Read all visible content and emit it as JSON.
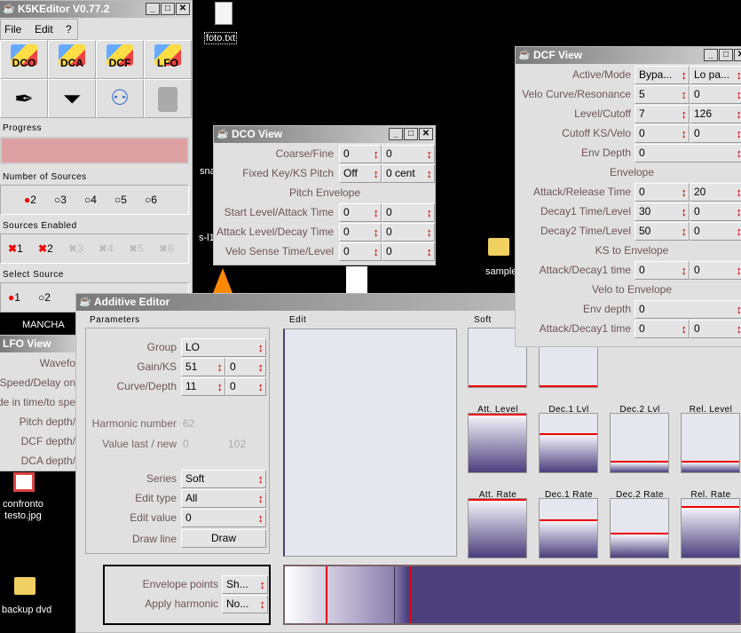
{
  "desktop": {
    "icons": [
      {
        "label": "foto.txt"
      },
      {
        "label": "sna"
      },
      {
        "label": "s-l1"
      },
      {
        "label": "sample"
      },
      {
        "label": "confronto\ntesto.jpg"
      },
      {
        "label": "backup dvd"
      },
      {
        "label": "MANCHA"
      }
    ]
  },
  "k5k": {
    "title": "K5KEditor V0.77.2",
    "menu": [
      "File",
      "Edit",
      "?"
    ],
    "toolbar": [
      "DCO",
      "DCA",
      "DCF",
      "LFO"
    ],
    "progress_label": "Progress",
    "progress": 0,
    "num_sources_label": "Number of Sources",
    "num_sources": [
      "2",
      "3",
      "4",
      "5",
      "6"
    ],
    "num_sources_selected": "2",
    "enabled_label": "Sources Enabled",
    "enabled": [
      "1",
      "2",
      "3",
      "4",
      "5",
      "6"
    ],
    "select_label": "Select Source",
    "select": [
      "1",
      "2"
    ],
    "select_selected": "1"
  },
  "lfo": {
    "title": "LFO View",
    "labels": [
      "Wavefo",
      "Speed/Delay on",
      "de in time/to spe",
      "Pitch depth/",
      "DCF depth/",
      "DCA depth/"
    ]
  },
  "dco": {
    "title": "DCO View",
    "rows": [
      {
        "label": "Coarse/Fine",
        "values": [
          "0",
          "0"
        ]
      },
      {
        "label": "Fixed Key/KS Pitch",
        "values": [
          "Off",
          "0 cent"
        ]
      },
      {
        "section": "Pitch Envelope"
      },
      {
        "label": "Start Level/Attack Time",
        "values": [
          "0",
          "0"
        ]
      },
      {
        "label": "Attack Level/Decay Time",
        "values": [
          "0",
          "0"
        ]
      },
      {
        "label": "Velo Sense Time/Level",
        "values": [
          "0",
          "0"
        ]
      }
    ]
  },
  "dcf": {
    "title": "DCF View",
    "rows": [
      {
        "label": "Active/Mode",
        "values": [
          "Bypa...",
          "Lo pa..."
        ]
      },
      {
        "label": "Velo Curve/Resonance",
        "values": [
          "5",
          "0"
        ]
      },
      {
        "label": "Level/Cutoff",
        "values": [
          "7",
          "126"
        ]
      },
      {
        "label": "Cutoff KS/Velo",
        "values": [
          "0",
          "0"
        ]
      },
      {
        "label": "Env Depth",
        "values": [
          "0"
        ]
      },
      {
        "section": "Envelope"
      },
      {
        "label": "Attack/Release Time",
        "values": [
          "0",
          "20"
        ]
      },
      {
        "label": "Decay1 Time/Level",
        "values": [
          "30",
          "0"
        ]
      },
      {
        "label": "Decay2 Time/Level",
        "values": [
          "50",
          "0"
        ]
      },
      {
        "section": "KS to Envelope"
      },
      {
        "label": "Attack/Decay1 time",
        "values": [
          "0",
          "0"
        ]
      },
      {
        "section": "Velo to Envelope"
      },
      {
        "label": "Env depth",
        "values": [
          "0"
        ]
      },
      {
        "label": "Attack/Decay1 time",
        "values": [
          "0",
          "0"
        ]
      }
    ]
  },
  "additive": {
    "title": "Additive Editor",
    "parameters_label": "Parameters",
    "edit_label": "Edit",
    "soft_label": "Soft",
    "params": [
      {
        "label": "Group",
        "values": [
          "LO"
        ]
      },
      {
        "label": "Gain/KS",
        "values": [
          "51",
          "0"
        ]
      },
      {
        "label": "Curve/Depth",
        "values": [
          "11",
          "0"
        ]
      }
    ],
    "harmonic_label": "Harmonic number",
    "harmonic": "62",
    "value_label": "Value last / new",
    "value_last": "0",
    "value_new": "102",
    "params2": [
      {
        "label": "Series",
        "values": [
          "Soft"
        ]
      },
      {
        "label": "Edit type",
        "values": [
          "All"
        ]
      },
      {
        "label": "Edit value",
        "values": [
          "0"
        ]
      }
    ],
    "draw_line_label": "Draw line",
    "draw_button": "Draw",
    "bottom": [
      {
        "label": "Envelope points",
        "values": [
          "Sh..."
        ]
      },
      {
        "label": "Apply harmonic",
        "values": [
          "No..."
        ]
      }
    ],
    "levels": [
      {
        "label": "Att. Level",
        "value": 97
      },
      {
        "label": "Dec.1 Lvl",
        "value": 63
      },
      {
        "label": "Dec.2 Lvl",
        "value": 17
      },
      {
        "label": "Rel. Level",
        "value": 17
      }
    ],
    "rates": [
      {
        "label": "Att. Rate",
        "value": 97
      },
      {
        "label": "Dec.1 Rate",
        "value": 62
      },
      {
        "label": "Dec.2 Rate",
        "value": 40
      },
      {
        "label": "Rel. Rate",
        "value": 85
      }
    ],
    "colors": {
      "fill": "#4b3f7c",
      "marker": "#ee0000"
    }
  }
}
